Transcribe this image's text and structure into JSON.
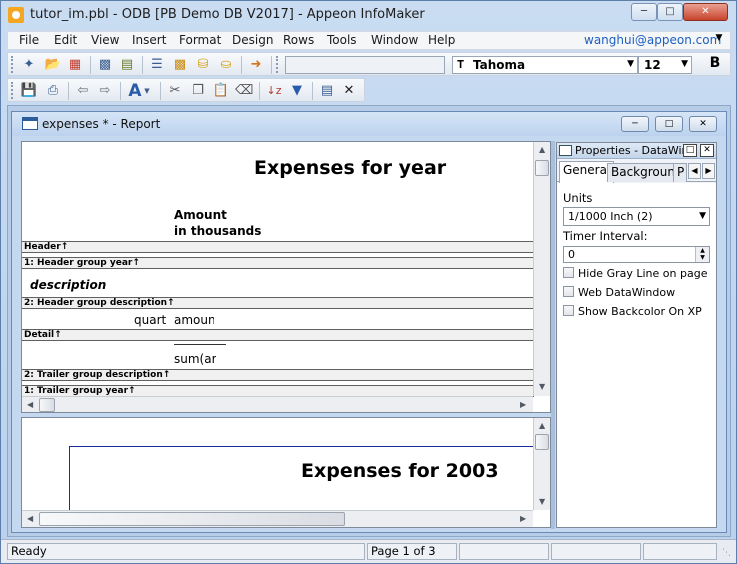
{
  "window": {
    "title": "tutor_im.pbl - ODB [PB Demo DB V2017]  - Appeon InfoMaker",
    "min_label": "─",
    "max_label": "□",
    "close_label": "✕"
  },
  "menubar": {
    "items": [
      "File",
      "Edit",
      "View",
      "Insert",
      "Format",
      "Design",
      "Rows",
      "Tools",
      "Window",
      "Help"
    ],
    "user_email": "wanghui@appeon.com",
    "overflow_glyph": "▼"
  },
  "toolbar1": {
    "icons": [
      "new-icon",
      "open-icon",
      "save-icon",
      "datawindow-icon",
      "library-icon",
      "list-icon",
      "chart-icon",
      "database-icon",
      "database-profile-icon",
      "exit-icon"
    ],
    "datawindow_combo_value": "",
    "font_name": "Tahoma",
    "font_size": "12",
    "bold_label": "B"
  },
  "toolbar2": {
    "icons": [
      "save-icon",
      "print-icon",
      "undo-icon",
      "redo-icon",
      "text-icon",
      "cut-icon",
      "copy-icon",
      "paste-icon",
      "clear-icon",
      "sort-icon",
      "filter-icon",
      "page-icon",
      "close-icon"
    ]
  },
  "child_window": {
    "title": "expenses * - Report",
    "min_label": "─",
    "max_label": "□",
    "close_label": "✕"
  },
  "design": {
    "title_text": "Expenses for  year",
    "amount_label_1": "Amount",
    "amount_label_2": "in thousands",
    "bands": [
      "Header↑",
      "1: Header group year↑",
      "2: Header group description↑",
      "Detail↑",
      "2: Trailer group description↑",
      "1: Trailer group year↑"
    ],
    "description_field": "description",
    "quart_field": "quart",
    "amount_field": "amoun",
    "sum_field": "sum(ar"
  },
  "preview": {
    "title_text": "Expenses for  2003"
  },
  "properties": {
    "title": "Properties - DataWindow",
    "pin_label": "□",
    "close_label": "✕",
    "tabs": [
      "General",
      "Background",
      "P"
    ],
    "active_tab": "General",
    "units_label": "Units",
    "units_value": "1/1000 Inch (2)",
    "timer_label": "Timer Interval:",
    "timer_value": "0",
    "checkboxes": [
      {
        "label": "Hide Gray Line on page break",
        "checked": false
      },
      {
        "label": "Web DataWindow",
        "checked": false
      },
      {
        "label": "Show Backcolor On XP",
        "checked": false
      }
    ]
  },
  "statusbar": {
    "status": "Ready",
    "page": "Page 1 of 3"
  }
}
